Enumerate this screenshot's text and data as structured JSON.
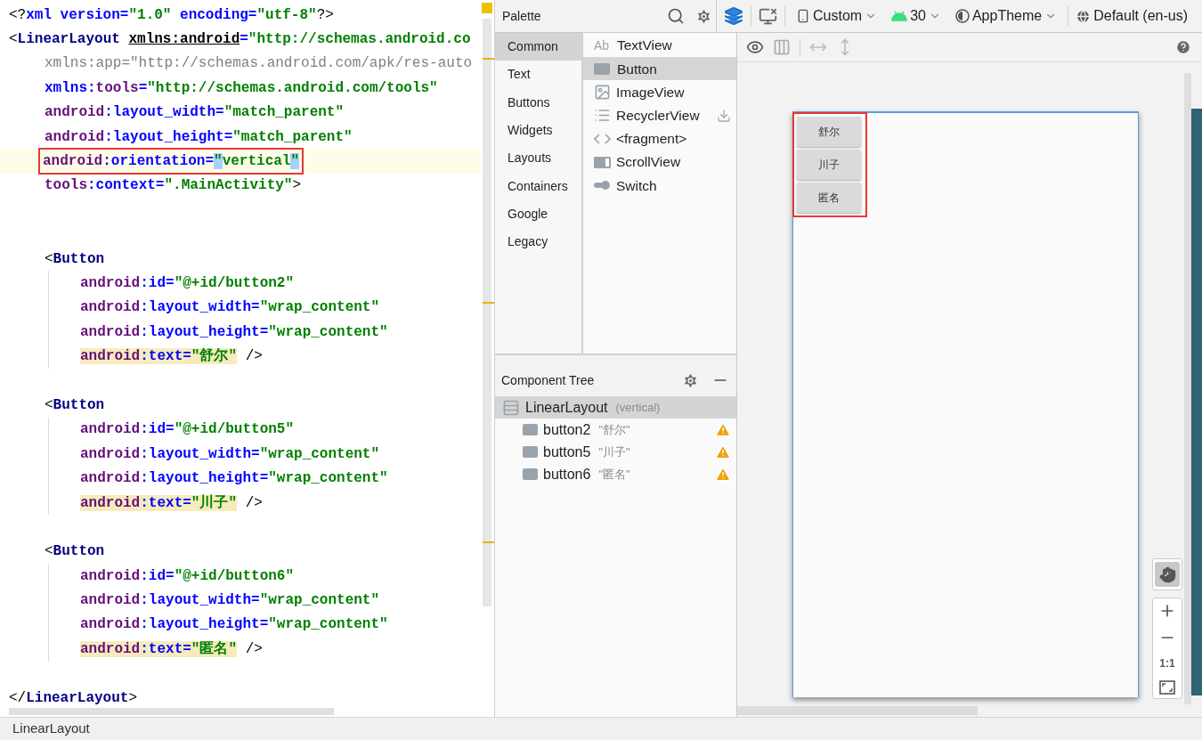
{
  "editor": {
    "lines": [
      {
        "kind": "root",
        "current": false,
        "boxed": false,
        "tokens": [
          {
            "t": "<?",
            "kind": "punct"
          },
          {
            "t": "xml version=",
            "kind": "attr"
          },
          {
            "t": "\"1.0\"",
            "kind": "value"
          },
          {
            "t": " encoding=",
            "kind": "attr"
          },
          {
            "t": "\"utf-8\"",
            "kind": "value"
          },
          {
            "t": "?>",
            "kind": "punct"
          }
        ]
      },
      {
        "kind": "root",
        "current": false,
        "boxed": false,
        "tokens": [
          {
            "t": "<",
            "kind": "punct"
          },
          {
            "t": "LinearLayout",
            "kind": "tag"
          },
          {
            "t": "xmlns:android",
            "kind": "decl"
          },
          {
            "t": "=",
            "kind": "attr"
          },
          {
            "t": "\"http://schemas.android.co",
            "kind": "value"
          }
        ]
      },
      {
        "kind": "attr",
        "current": false,
        "boxed": false,
        "tokens": [
          {
            "t": "xmlns:app=\"http://schemas.android.com/apk/res-auto",
            "kind": "dim"
          }
        ]
      },
      {
        "kind": "attr",
        "current": false,
        "boxed": false,
        "tokens": [
          {
            "t": "xmlns:",
            "kind": "attr"
          },
          {
            "t": "tools",
            "kind": "ns"
          },
          {
            "t": "=",
            "kind": "attr"
          },
          {
            "t": "\"http://schemas.android.com/tools\"",
            "kind": "value"
          }
        ]
      },
      {
        "kind": "attr",
        "current": false,
        "boxed": false,
        "tokens": [
          {
            "t": "android",
            "kind": "ns"
          },
          {
            "t": ":layout_width=",
            "kind": "attr"
          },
          {
            "t": "\"match_parent\"",
            "kind": "value"
          }
        ]
      },
      {
        "kind": "attr",
        "current": false,
        "boxed": false,
        "tokens": [
          {
            "t": "android",
            "kind": "ns"
          },
          {
            "t": ":layout_height=",
            "kind": "attr"
          },
          {
            "t": "\"match_parent\"",
            "kind": "value"
          }
        ]
      },
      {
        "kind": "attr",
        "current": true,
        "boxed": true,
        "tokens": [
          {
            "t": "android",
            "kind": "ns"
          },
          {
            "t": ":orientation=",
            "kind": "attr"
          },
          {
            "t": "\"",
            "kind": "value_selected"
          },
          {
            "t": "vertical",
            "kind": "value"
          },
          {
            "t": "\"",
            "kind": "value_selected"
          }
        ]
      },
      {
        "kind": "attr",
        "current": false,
        "boxed": false,
        "tokens": [
          {
            "t": "tools",
            "kind": "ns"
          },
          {
            "t": ":context=",
            "kind": "attr"
          },
          {
            "t": "\".MainActivity\"",
            "kind": "value"
          },
          {
            "t": ">",
            "kind": "punct"
          }
        ]
      },
      {
        "kind": "blank",
        "current": false
      },
      {
        "kind": "blank",
        "current": false
      },
      {
        "kind": "attr",
        "current": false,
        "boxed": false,
        "tokens": [
          {
            "t": "<",
            "kind": "punct"
          },
          {
            "t": "Button",
            "kind": "tag"
          }
        ]
      },
      {
        "kind": "nested",
        "current": false,
        "boxed": false,
        "tokens": [
          {
            "t": "android",
            "kind": "ns"
          },
          {
            "t": ":id=",
            "kind": "attr"
          },
          {
            "t": "\"@+id/button2\"",
            "kind": "value"
          }
        ]
      },
      {
        "kind": "nested",
        "current": false,
        "boxed": false,
        "tokens": [
          {
            "t": "android",
            "kind": "ns"
          },
          {
            "t": ":layout_width=",
            "kind": "attr"
          },
          {
            "t": "\"wrap_content\"",
            "kind": "value"
          }
        ]
      },
      {
        "kind": "nested",
        "current": false,
        "boxed": false,
        "tokens": [
          {
            "t": "android",
            "kind": "ns"
          },
          {
            "t": ":layout_height=",
            "kind": "attr"
          },
          {
            "t": "\"wrap_content\"",
            "kind": "value"
          }
        ]
      },
      {
        "kind": "nested",
        "current": false,
        "boxed": false,
        "tokens": [
          {
            "t": "android",
            "kind": "ns_usage"
          },
          {
            "t": ":text=",
            "kind": "attr_usage"
          },
          {
            "t": "\"舒尔\"",
            "kind": "value_usage"
          },
          {
            "t": " />",
            "kind": "punct"
          }
        ]
      },
      {
        "kind": "blank",
        "current": false
      },
      {
        "kind": "attr",
        "current": false,
        "boxed": false,
        "tokens": [
          {
            "t": "<",
            "kind": "punct"
          },
          {
            "t": "Button",
            "kind": "tag"
          }
        ]
      },
      {
        "kind": "nested",
        "current": false,
        "boxed": false,
        "tokens": [
          {
            "t": "android",
            "kind": "ns"
          },
          {
            "t": ":id=",
            "kind": "attr"
          },
          {
            "t": "\"@+id/button5\"",
            "kind": "value"
          }
        ]
      },
      {
        "kind": "nested",
        "current": false,
        "boxed": false,
        "tokens": [
          {
            "t": "android",
            "kind": "ns"
          },
          {
            "t": ":layout_width=",
            "kind": "attr"
          },
          {
            "t": "\"wrap_content\"",
            "kind": "value"
          }
        ]
      },
      {
        "kind": "nested",
        "current": false,
        "boxed": false,
        "tokens": [
          {
            "t": "android",
            "kind": "ns"
          },
          {
            "t": ":layout_height=",
            "kind": "attr"
          },
          {
            "t": "\"wrap_content\"",
            "kind": "value"
          }
        ]
      },
      {
        "kind": "nested",
        "current": false,
        "boxed": false,
        "tokens": [
          {
            "t": "android",
            "kind": "ns_usage"
          },
          {
            "t": ":text=",
            "kind": "attr_usage"
          },
          {
            "t": "\"川子\"",
            "kind": "value_usage"
          },
          {
            "t": " />",
            "kind": "punct"
          }
        ]
      },
      {
        "kind": "blank",
        "current": false
      },
      {
        "kind": "attr",
        "current": false,
        "boxed": false,
        "tokens": [
          {
            "t": "<",
            "kind": "punct"
          },
          {
            "t": "Button",
            "kind": "tag"
          }
        ]
      },
      {
        "kind": "nested",
        "current": false,
        "boxed": false,
        "tokens": [
          {
            "t": "android",
            "kind": "ns"
          },
          {
            "t": ":id=",
            "kind": "attr"
          },
          {
            "t": "\"@+id/button6\"",
            "kind": "value"
          }
        ]
      },
      {
        "kind": "nested",
        "current": false,
        "boxed": false,
        "tokens": [
          {
            "t": "android",
            "kind": "ns"
          },
          {
            "t": ":layout_width=",
            "kind": "attr"
          },
          {
            "t": "\"wrap_content\"",
            "kind": "value"
          }
        ]
      },
      {
        "kind": "nested",
        "current": false,
        "boxed": false,
        "tokens": [
          {
            "t": "android",
            "kind": "ns"
          },
          {
            "t": ":layout_height=",
            "kind": "attr"
          },
          {
            "t": "\"wrap_content\"",
            "kind": "value"
          }
        ]
      },
      {
        "kind": "nested",
        "current": false,
        "boxed": false,
        "tokens": [
          {
            "t": "android",
            "kind": "ns_usage"
          },
          {
            "t": ":text=",
            "kind": "attr_usage"
          },
          {
            "t": "\"匿名\"",
            "kind": "value_usage"
          },
          {
            "t": " />",
            "kind": "punct"
          }
        ]
      },
      {
        "kind": "blank",
        "current": false
      },
      {
        "kind": "root",
        "current": false,
        "boxed": false,
        "tokens": [
          {
            "t": "</",
            "kind": "punct"
          },
          {
            "t": "LinearLayout",
            "kind": "tag"
          },
          {
            "t": ">",
            "kind": "punct"
          }
        ]
      }
    ]
  },
  "palette": {
    "title": "Palette",
    "categories": [
      {
        "label": "Common",
        "selected": true
      },
      {
        "label": "Text",
        "selected": false
      },
      {
        "label": "Buttons",
        "selected": false
      },
      {
        "label": "Widgets",
        "selected": false
      },
      {
        "label": "Layouts",
        "selected": false
      },
      {
        "label": "Containers",
        "selected": false
      },
      {
        "label": "Google",
        "selected": false
      },
      {
        "label": "Legacy",
        "selected": false
      }
    ],
    "items": [
      {
        "label": "TextView",
        "kind": "text",
        "icon_text": "Ab",
        "selected": false,
        "downloadable": false
      },
      {
        "label": "Button",
        "kind": "button",
        "selected": true,
        "downloadable": false
      },
      {
        "label": "ImageView",
        "kind": "image",
        "selected": false,
        "downloadable": false
      },
      {
        "label": "RecyclerView",
        "kind": "list",
        "selected": false,
        "downloadable": true
      },
      {
        "label": "<fragment>",
        "kind": "fragment",
        "selected": false,
        "downloadable": false
      },
      {
        "label": "ScrollView",
        "kind": "scroll",
        "selected": false,
        "downloadable": false
      },
      {
        "label": "Switch",
        "kind": "switch",
        "selected": false,
        "downloadable": false
      }
    ]
  },
  "design_toolbar": {
    "device": "Custom",
    "api": "30",
    "theme": "AppTheme",
    "locale": "Default (en-us)"
  },
  "preview": {
    "boxed": true,
    "buttons": [
      {
        "label": "舒尔"
      },
      {
        "label": "川子"
      },
      {
        "label": "匿名"
      }
    ]
  },
  "zoom_controls": {
    "actual_size": "1:1"
  },
  "component_tree": {
    "title": "Component Tree",
    "nodes": [
      {
        "name": "LinearLayout",
        "detail": "(vertical)",
        "selected": true,
        "warning": false,
        "children": [
          {
            "name": "button2",
            "detail": "\"舒尔\"",
            "selected": false,
            "warning": true
          },
          {
            "name": "button5",
            "detail": "\"川子\"",
            "selected": false,
            "warning": true
          },
          {
            "name": "button6",
            "detail": "\"匿名\"",
            "selected": false,
            "warning": true
          }
        ]
      }
    ]
  },
  "status_bar": {
    "text": "LinearLayout"
  }
}
